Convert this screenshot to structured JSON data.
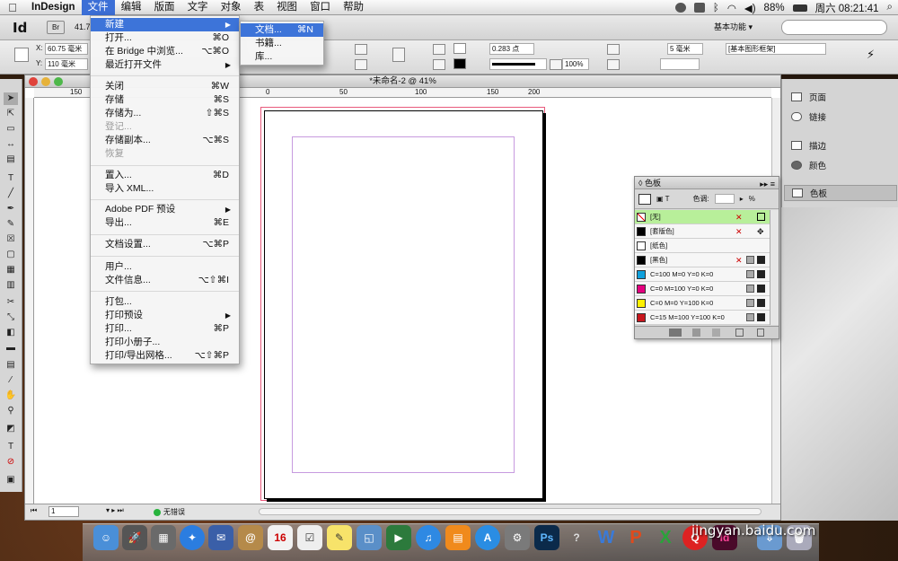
{
  "menubar": {
    "items": [
      "InDesign",
      "文件",
      "编辑",
      "版面",
      "文字",
      "对象",
      "表",
      "视图",
      "窗口",
      "帮助"
    ],
    "battery": "88%",
    "clock": "周六 08:21:41"
  },
  "app_bar": {
    "logo": "Id",
    "bridge": "Br",
    "zoom": "41.7",
    "workspace": "基本功能"
  },
  "control_panel": {
    "x_label": "X:",
    "x_value": "60.75 毫米",
    "y_label": "Y:",
    "y_value": "110 毫米",
    "stroke_weight": "0.283 点",
    "opacity": "100%",
    "spacing": "5 毫米",
    "frame_style": "[基本图形框架]"
  },
  "document": {
    "title": "*未命名-2 @ 41%",
    "ruler_ticks": [
      "150",
      "0",
      "50",
      "100",
      "150",
      "200"
    ],
    "page_number": "1",
    "preflight": "无错误"
  },
  "file_menu": {
    "items": [
      {
        "label": "新建",
        "shortcut": "",
        "arrow": true,
        "highlighted": true
      },
      {
        "label": "打开...",
        "shortcut": "⌘O"
      },
      {
        "label": "在 Bridge 中浏览...",
        "shortcut": "⌥⌘O"
      },
      {
        "label": "最近打开文件",
        "shortcut": "",
        "arrow": true
      },
      {
        "label": "关闭",
        "shortcut": "⌘W"
      },
      {
        "label": "存储",
        "shortcut": "⌘S"
      },
      {
        "label": "存储为...",
        "shortcut": "⇧⌘S"
      },
      {
        "label": "登记...",
        "shortcut": "",
        "disabled": true
      },
      {
        "label": "存储副本...",
        "shortcut": "⌥⌘S"
      },
      {
        "label": "恢复",
        "shortcut": "",
        "disabled": true
      },
      {
        "label": "置入...",
        "shortcut": "⌘D"
      },
      {
        "label": "导入 XML...",
        "shortcut": ""
      },
      {
        "label": "Adobe PDF 预设",
        "shortcut": "",
        "arrow": true
      },
      {
        "label": "导出...",
        "shortcut": "⌘E"
      },
      {
        "label": "文档设置...",
        "shortcut": "⌥⌘P"
      },
      {
        "label": "用户...",
        "shortcut": ""
      },
      {
        "label": "文件信息...",
        "shortcut": "⌥⇧⌘I"
      },
      {
        "label": "打包...",
        "shortcut": ""
      },
      {
        "label": "打印预设",
        "shortcut": "",
        "arrow": true
      },
      {
        "label": "打印...",
        "shortcut": "⌘P"
      },
      {
        "label": "打印小册子...",
        "shortcut": ""
      },
      {
        "label": "打印/导出网格...",
        "shortcut": "⌥⇧⌘P"
      }
    ]
  },
  "new_submenu": {
    "items": [
      {
        "label": "文档...",
        "shortcut": "⌘N",
        "highlighted": true
      },
      {
        "label": "书籍...",
        "shortcut": ""
      },
      {
        "label": "库...",
        "shortcut": ""
      }
    ]
  },
  "panel_dock": {
    "items": [
      "页面",
      "链接",
      "描边",
      "颜色",
      "色板"
    ]
  },
  "swatches": {
    "title": "色板",
    "tint_label": "色调:",
    "percent": "%",
    "rows": [
      {
        "name": "[无]",
        "color": "none"
      },
      {
        "name": "[套版色]",
        "color": "#000000"
      },
      {
        "name": "[纸色]",
        "color": "#ffffff"
      },
      {
        "name": "[黑色]",
        "color": "#000000"
      },
      {
        "name": "C=100 M=0 Y=0 K=0",
        "color": "#0fa0dc"
      },
      {
        "name": "C=0 M=100 Y=0 K=0",
        "color": "#e4007f"
      },
      {
        "name": "C=0 M=0 Y=100 K=0",
        "color": "#fff100"
      },
      {
        "name": "C=15 M=100 Y=100 K=0",
        "color": "#c8161d"
      }
    ]
  },
  "watermark": "jingyan.baidu.com"
}
